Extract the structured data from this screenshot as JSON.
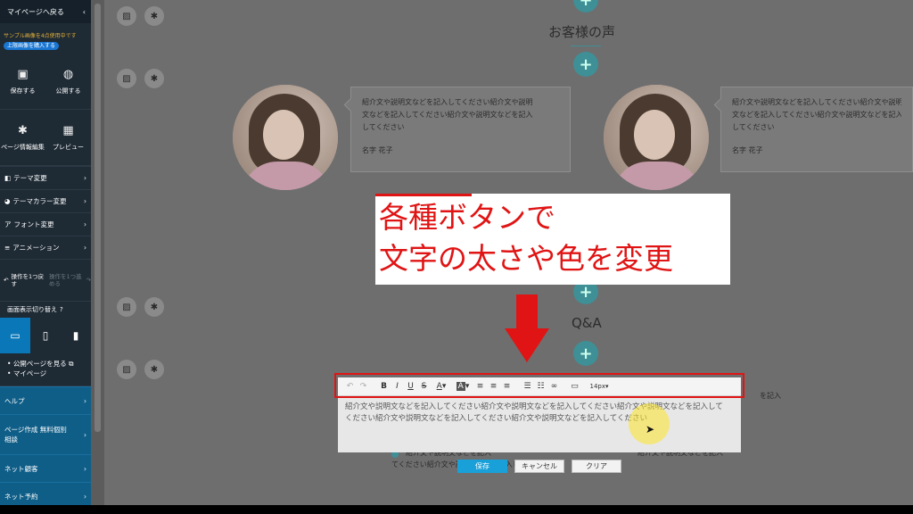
{
  "sidebar": {
    "back_label": "マイページへ戻る",
    "notice": "サンプル画像を4点使用中です",
    "notice_chip": "上限画像を購入する",
    "grid": [
      {
        "icon": "save-icon",
        "glyph": "▣",
        "label": "保存する"
      },
      {
        "icon": "publish-icon",
        "glyph": "◍",
        "label": "公開する"
      },
      {
        "icon": "gear-icon",
        "glyph": "✱",
        "label": "ページ情報編集"
      },
      {
        "icon": "preview-icon",
        "glyph": "▦",
        "label": "プレビュー"
      }
    ],
    "menu": [
      {
        "icon": "◧",
        "label": "テーマ変更"
      },
      {
        "icon": "◕",
        "label": "テーマカラー変更"
      },
      {
        "icon": "ア",
        "label": "フォント変更"
      },
      {
        "icon": "≡",
        "label": "アニメーション"
      }
    ],
    "undo_label": "操作を1つ戻す",
    "redo_label": "操作を1つ進める",
    "switch_label": "画面表示切り替え",
    "links": [
      "公開ページを見る",
      "マイページ"
    ],
    "blue_menu": [
      "ヘルプ",
      "ページ作成 無料個別相談",
      "ネット顧客",
      "ネット予約"
    ]
  },
  "main": {
    "section1_title": "お客様の声",
    "testimonial_text": "紹介文や説明文などを記入してください紹介文や説明文などを記入してください紹介文や説明文などを記入してください",
    "testimonial_lines": [
      "紹介文や説明文などを記入してください紹介文や説明",
      "文などを記入してください紹介文や説明文などを記入",
      "してください"
    ],
    "name": "名字 花子",
    "overlay_line1": "各種ボタンで",
    "overlay_line2": "文字の太さや色を変更",
    "qa_title": "Q&A",
    "editor_lines": [
      "紹介文や説明文などを記入してください紹介文や説明文などを記入してください紹介文や説明文などを記入して",
      "ください紹介文や説明文などを記入してください紹介文や説明文などを記入してください"
    ],
    "toolbar_fontsize": "14px",
    "bg_right_1": "を記入",
    "bg_right_2": "紹介文や説明文などを記入",
    "bg_lower_1": "紹介文や説明文などを記入",
    "bg_lower_2": "てください紹介文や説明文などを記入してください",
    "btn_save": "保存",
    "btn_cancel": "キャンセル",
    "btn_clear": "クリア"
  },
  "colors": {
    "accent": "#3f8f96",
    "highlight_red": "#e01414",
    "save_blue": "#1aa0d8",
    "sidebar_bg": "#1e2a34"
  }
}
